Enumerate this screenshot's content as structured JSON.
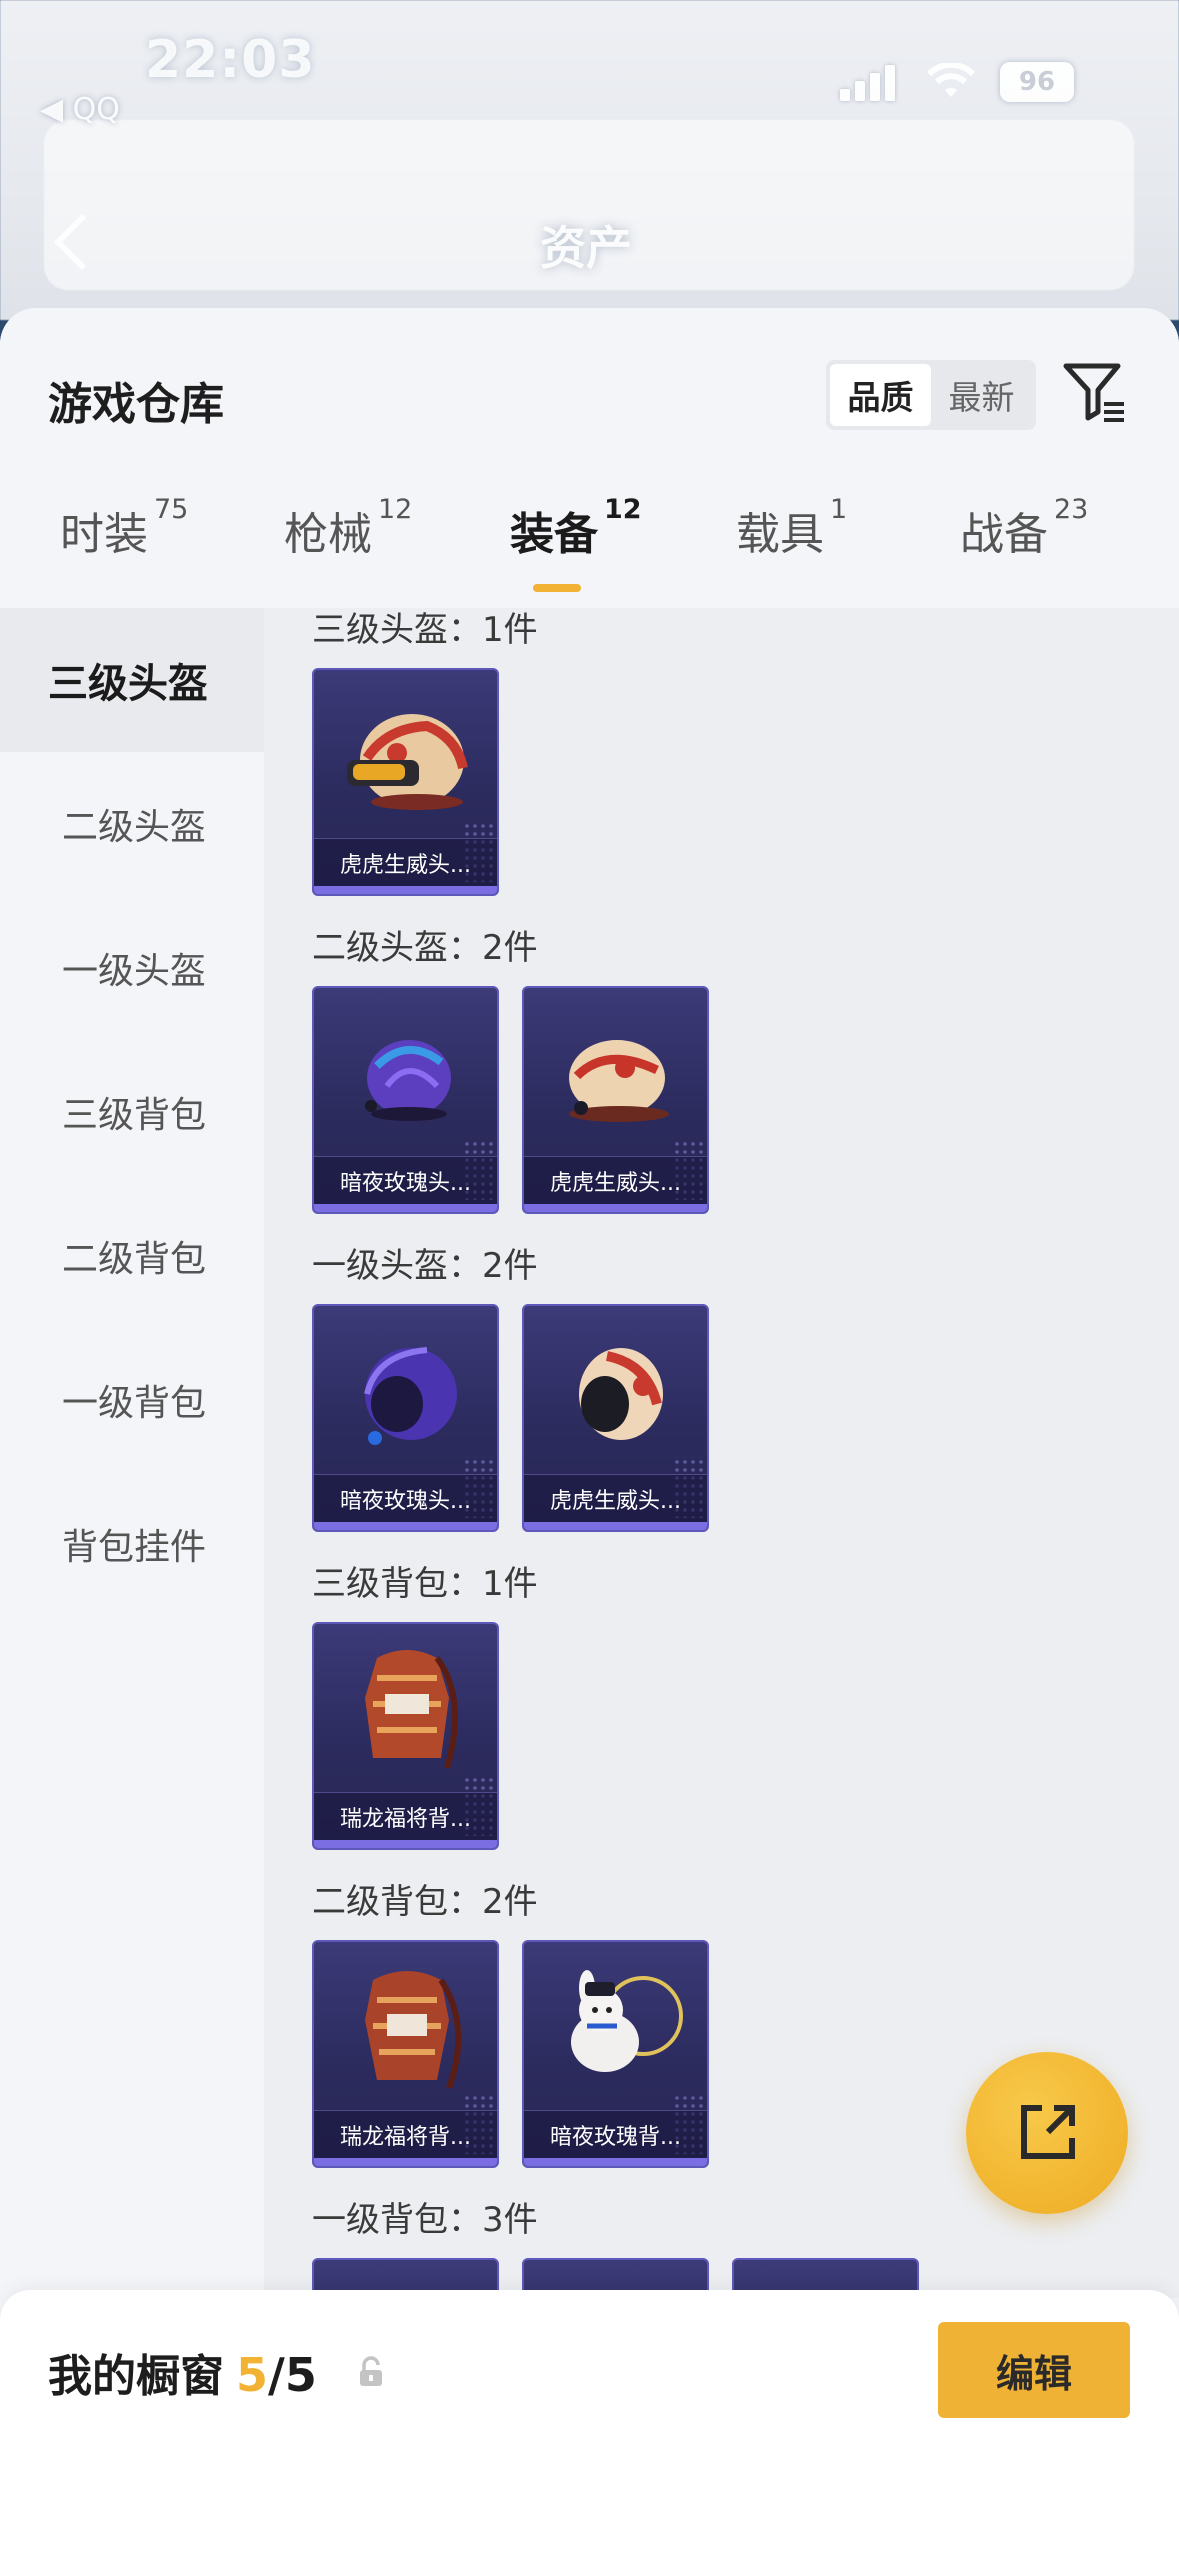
{
  "status_bar": {
    "time": "22:03",
    "carrier_back": "◀ QQ",
    "battery": "96"
  },
  "nav": {
    "title": "资产"
  },
  "header": {
    "title": "游戏仓库",
    "sort_options": [
      "品质",
      "最新"
    ],
    "sort_selected": "品质"
  },
  "tabs": [
    {
      "label": "时装",
      "count": "75"
    },
    {
      "label": "枪械",
      "count": "12"
    },
    {
      "label": "装备",
      "count": "12",
      "active": true
    },
    {
      "label": "载具",
      "count": "1"
    },
    {
      "label": "战备",
      "count": "23"
    }
  ],
  "sidebar": {
    "items": [
      {
        "label": "三级头盔",
        "active": true
      },
      {
        "label": "二级头盔"
      },
      {
        "label": "一级头盔"
      },
      {
        "label": "三级背包"
      },
      {
        "label": "二级背包"
      },
      {
        "label": "一级背包"
      },
      {
        "label": "背包挂件"
      }
    ]
  },
  "groups": [
    {
      "title": "三级头盔：1件",
      "items": [
        {
          "name": "虎虎生威头...",
          "icon": "helmet-tiger-icon"
        }
      ]
    },
    {
      "title": "二级头盔：2件",
      "items": [
        {
          "name": "暗夜玫瑰头...",
          "icon": "helmet-rose-icon"
        },
        {
          "name": "虎虎生威头...",
          "icon": "helmet-tiger-icon"
        }
      ]
    },
    {
      "title": "一级头盔：2件",
      "items": [
        {
          "name": "暗夜玫瑰头...",
          "icon": "helmet-rose-icon"
        },
        {
          "name": "虎虎生威头...",
          "icon": "helmet-tiger-icon"
        }
      ]
    },
    {
      "title": "三级背包：1件",
      "items": [
        {
          "name": "瑞龙福将背...",
          "icon": "backpack-dragon-icon"
        }
      ]
    },
    {
      "title": "二级背包：2件",
      "items": [
        {
          "name": "瑞龙福将背...",
          "icon": "backpack-dragon-icon"
        },
        {
          "name": "暗夜玫瑰背...",
          "icon": "backpack-rabbit-icon"
        }
      ]
    },
    {
      "title": "一级背包：3件",
      "items": []
    }
  ],
  "showcase": {
    "title": "我的橱窗",
    "current": "5",
    "sep": "/",
    "total": "5",
    "edit_label": "编辑"
  },
  "colors": {
    "accent": "#f2b233",
    "card_bg": "#2c2b5e",
    "card_border": "#5e58b8"
  }
}
